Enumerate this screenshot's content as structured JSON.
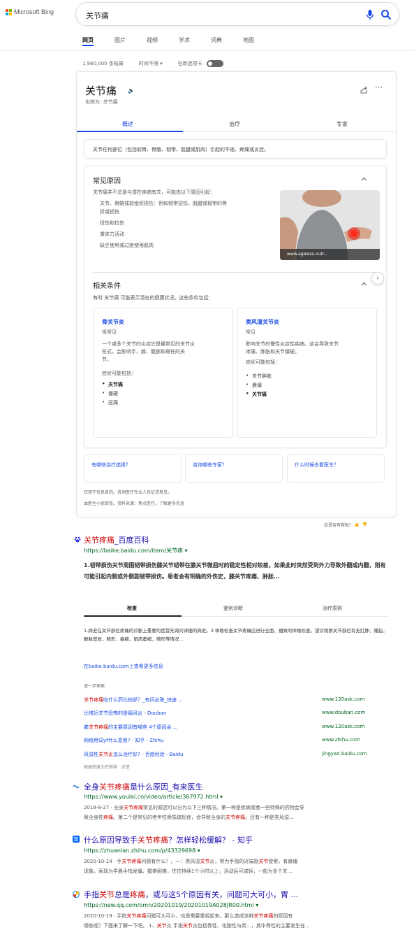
{
  "header": {
    "brand": "Microsoft Bing",
    "brand_colors": [
      "#f25022",
      "#7fba00",
      "#00a4ef",
      "#ffb900"
    ],
    "query": "关节痛"
  },
  "tabs": [
    "网页",
    "图片",
    "视频",
    "学术",
    "词典",
    "地图"
  ],
  "meta": {
    "result_count": "1,960,000 条结果",
    "time_filter": "时间不限",
    "open_link_label": "在新选项卡"
  },
  "kp": {
    "title": "关节痛",
    "aka": "也称为: 关节痛",
    "tabs": [
      "概述",
      "治疗",
      "专家"
    ],
    "definition": "关节任何部位（包括软骨、骨骼、韧带、肌腱或肌肉）引起的不适、疼痛或炎症。",
    "causes": {
      "title": "常见原因",
      "intro": "关节痛并不总是与潜在疾病有关，可能由以下原因引起：",
      "items": [
        "关节、骨骼或软组织损伤：例如韧带扭伤、肌腱或韧带的骨",
        "折或损伤",
        "扭伤和拉伤",
        "重体力活动",
        "缺乏使用或过度使用肌肉"
      ],
      "image_caption": "www.ageless-nutr..."
    },
    "related": {
      "title": "相关条件",
      "intro": "有时 关节痛 可能表示潜在的健康状况。这些条件包括：",
      "cards": [
        {
          "title": "骨关节炎",
          "freq": "很常见",
          "desc": [
            "一个或多个关节的炎症它是最常见的关节炎",
            "形式，会影响手、膝、髋部和脊柱的关",
            "节。"
          ],
          "symptoms_label": "症状可能包括：",
          "symptoms": [
            "关节痛",
            "僵硬",
            "压痛"
          ]
        },
        {
          "title": "类风湿关节炎",
          "freq": "常见",
          "desc": [
            "影响关节的慢性炎症性疾病。这会导致关节",
            "疼痛、肿胀和关节僵硬。"
          ],
          "symptoms_label": "症状可能包括：",
          "symptoms": [
            "关节肿胀",
            "晨僵",
            "关节痛"
          ]
        }
      ]
    },
    "faqs": [
      "有哪些治疗选择？",
      "咨询哪些专家？",
      "什么时候去看医生？"
    ],
    "disclaimer1": "仅用于信息目的。咨询医疗专业人员征求意见。",
    "disclaimer2": "由医生小组审查。资料来源：焦点医疗。了解更多信息",
    "helpful": "这是否有帮助?"
  },
  "results": [
    {
      "title_parts": [
        [
          "关节疼痛",
          true
        ],
        [
          "_百度百科",
          false
        ]
      ],
      "url": "https://baike.baidu.com/item/关节疼 ▾",
      "summary": "1.韧带损伤关节周围韧带损伤膝关节韧带在膝关节微屈时的稳定性相对较差，如果此时突然受到外力导致外翻或内翻，则有可能引起内侧或外侧副韧带损伤。患者会有明确的外伤史，膝关节疼痛、肿胀…",
      "tabs": [
        "检查",
        "鉴别诊断",
        "治疗原则"
      ],
      "desc": "1.病史在关节部位疼痛的诊断上重要的是首先询问详细的病史。2.体格检查关节疼痛应进行全面、细致的体格检查。望诊观察关节部位有无红肿、隆起，静脉怒张，畸形、瘢痕，肌肉萎缩，畸形等情况…",
      "more_link": "在baike.baidu.com上查看更多信息",
      "explore_label": "进一步探索",
      "explore": [
        {
          "text_parts": [
            [
              "关节疼痛",
              true
            ],
            [
              "吃什么药比较好？_有问必答_快速 ...",
              false
            ]
          ],
          "domain": "www.120ask.com"
        },
        {
          "text_parts": [
            [
              "比塔近关节恐怖的是痛风炎 - Douban",
              false
            ]
          ],
          "domain": "www.douban.com"
        },
        {
          "text_parts": [
            [
              "膝",
              false
            ],
            [
              "关节疼痛",
              true
            ],
            [
              "的主要原因有哪些 4个原因会 ...",
              false
            ]
          ],
          "domain": "www.120ask.com"
        },
        {
          "text_parts": [
            [
              "网络用词yf什么意思? - 知乎 - Zhihu",
              false
            ]
          ],
          "domain": "www.zhihu.com"
        },
        {
          "text_parts": [
            [
              "风湿性",
              false
            ],
            [
              "关节炎",
              true
            ],
            [
              "怎么治疗好? - 百度经验 - Baidu",
              false
            ]
          ],
          "domain": "jingyan.baidu.com"
        }
      ],
      "explore_note": "根据热度为您推荐 · 反馈"
    },
    {
      "title_parts": [
        [
          "全身",
          false
        ],
        [
          "关节疼痛",
          true
        ],
        [
          "是什么原因_有来医生",
          false
        ]
      ],
      "url": "https://www.youlai.cn/video/article/367972.html ▾",
      "snippet_lines": [
        [
          [
            "2018-8-27 · 全身",
            false
          ],
          [
            "关节疼痛",
            true
          ],
          [
            "常见的原因可以分为以下三种情况。第一种是疾病或者一些特殊的药物会导",
            false
          ]
        ],
        [
          [
            "致全身性",
            false
          ],
          [
            "疼痛",
            true
          ],
          [
            "。第二个是常见的老年性骨质疏松症，会导致全身的",
            false
          ],
          [
            "关节疼痛",
            true
          ],
          [
            "。还有一种是类风湿…",
            false
          ]
        ]
      ]
    },
    {
      "title_parts": [
        [
          "什么原因导致手",
          false
        ],
        [
          "关节疼痛",
          true
        ],
        [
          "？怎样轻松缓解？ - 知乎",
          false
        ]
      ],
      "url": "https://zhuanlan.zhihu.com/p/43329698 ▾",
      "snippet_lines": [
        [
          [
            "2020-10-14 · 手",
            false
          ],
          [
            "关节疼痛",
            true
          ],
          [
            "问题有什么？。一：类风湿",
            false
          ],
          [
            "关节",
            true
          ],
          [
            "炎，常为手指的近端指",
            false
          ],
          [
            "关节",
            true
          ],
          [
            "受累，有晨僵",
            false
          ]
        ],
        [
          [
            "现象，表现为早晨手指发僵、握拳困难，往往持续1个小时以上，活动后可减轻，一般为多个关…",
            false
          ]
        ]
      ]
    },
    {
      "title_parts": [
        [
          "手指",
          false
        ],
        [
          "关节",
          true
        ],
        [
          "总是",
          false
        ],
        [
          "疼痛",
          true
        ],
        [
          "，或与这5个原因有关，问题可大可小，胃 ...",
          false
        ]
      ],
      "url": "https://new.qq.com/omn/20201019/20201019A028JR00.html ▾",
      "snippet_lines": [
        [
          [
            "2020-10-19 · 手指",
            false
          ],
          [
            "关节疼痛",
            true
          ],
          [
            "问题可大可小，也是需要重视起来。那么造成该种",
            false
          ],
          [
            "关节疼痛",
            true
          ],
          [
            "的原因有",
            false
          ]
        ],
        [
          [
            "哪些呢？下面来了解一下吧。 1、",
            false
          ],
          [
            "关节",
            true
          ],
          [
            "炎 手指",
            false
          ],
          [
            "关节",
            true
          ],
          [
            "炎包括骨性、化脓性与类…，其中骨性的主要发生在…",
            false
          ]
        ]
      ]
    }
  ]
}
